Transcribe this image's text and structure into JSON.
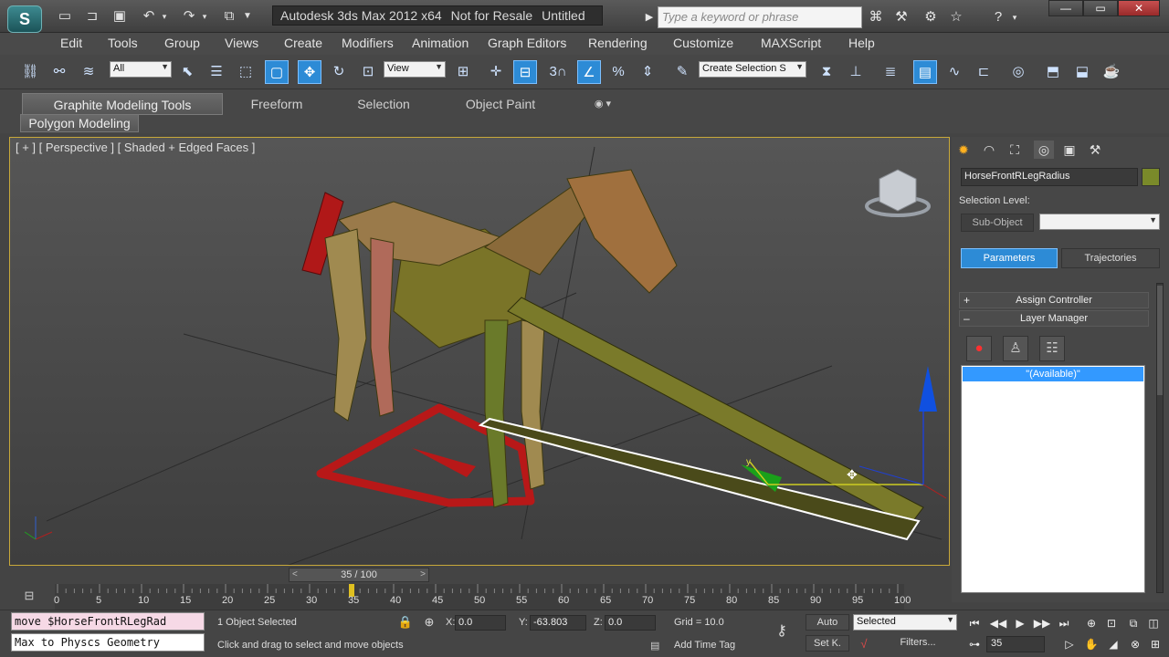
{
  "titlebar": {
    "app_title": "Autodesk 3ds Max  2012 x64",
    "resale_note": "Not for Resale",
    "doc_name": "Untitled",
    "search_placeholder": "Type a keyword or phrase",
    "logo_glyph": "S"
  },
  "menu": [
    "Edit",
    "Tools",
    "Group",
    "Views",
    "Create",
    "Modifiers",
    "Animation",
    "Graph Editors",
    "Rendering",
    "Customize",
    "MAXScript",
    "Help"
  ],
  "toolbar": {
    "selection_filter": "All",
    "ref_coord": "View",
    "named_selection": "Create Selection S",
    "snap_label": "3"
  },
  "ribbon": {
    "tabs": [
      "Graphite Modeling Tools",
      "Freeform",
      "Selection",
      "Object Paint"
    ],
    "panel": "Polygon Modeling"
  },
  "viewport": {
    "label": "[ + ] [ Perspective ] [ Shaded + Edged Faces ]",
    "gizmo_y_label": "y"
  },
  "command_panel": {
    "object_name": "HorseFrontRLegRadius",
    "selection_level_label": "Selection Level:",
    "sub_object_label": "Sub-Object",
    "parameters_label": "Parameters",
    "trajectories_label": "Trajectories",
    "assign_controller_label": "Assign Controller",
    "layer_manager_label": "Layer Manager",
    "plus_sign": "+",
    "minus_sign": "–",
    "available_item": "\"(Available)\""
  },
  "timeline": {
    "slider_label": "35 / 100",
    "ticks": [
      0,
      5,
      10,
      15,
      20,
      25,
      30,
      35,
      40,
      45,
      50,
      55,
      60,
      65,
      70,
      75,
      80,
      85,
      90,
      95,
      100
    ],
    "current_frame": 35
  },
  "status": {
    "maxscript_line1": "move $HorseFrontRLegRad",
    "maxscript_line2": "Max to Physcs Geometry",
    "selection_status": "1 Object Selected",
    "prompt": "Click and drag to select and move objects",
    "x_label": "X:",
    "x_value": "0.0",
    "y_label": "Y:",
    "y_value": "-63.803",
    "z_label": "Z:",
    "z_value": "0.0",
    "grid": "Grid = 10.0",
    "auto_key": "Auto",
    "set_key": "Set K.",
    "key_mode": "Selected",
    "filters": "Filters...",
    "add_time_tag": "Add Time Tag",
    "frame_value": "35"
  }
}
